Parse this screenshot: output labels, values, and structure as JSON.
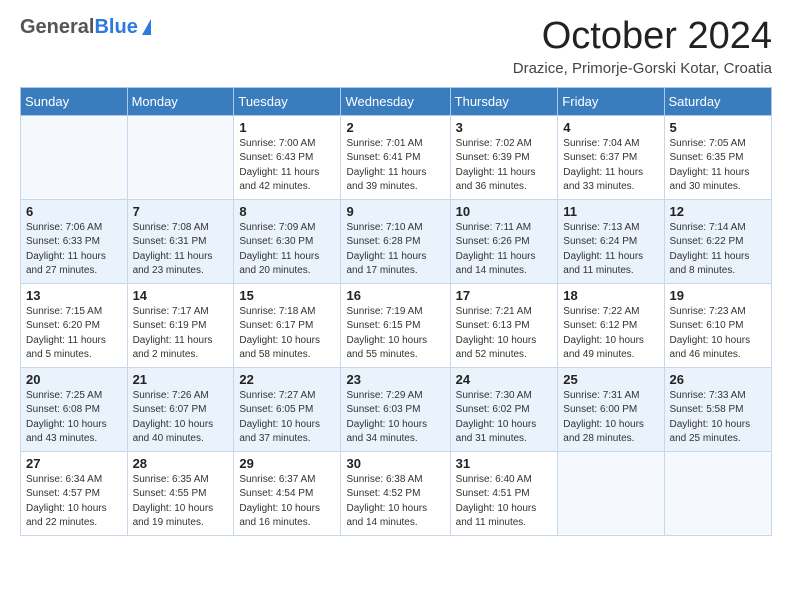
{
  "header": {
    "logo_general": "General",
    "logo_blue": "Blue",
    "title": "October 2024",
    "location": "Drazice, Primorje-Gorski Kotar, Croatia"
  },
  "days_of_week": [
    "Sunday",
    "Monday",
    "Tuesday",
    "Wednesday",
    "Thursday",
    "Friday",
    "Saturday"
  ],
  "weeks": [
    [
      {
        "day": "",
        "info": ""
      },
      {
        "day": "",
        "info": ""
      },
      {
        "day": "1",
        "info": "Sunrise: 7:00 AM\nSunset: 6:43 PM\nDaylight: 11 hours and 42 minutes."
      },
      {
        "day": "2",
        "info": "Sunrise: 7:01 AM\nSunset: 6:41 PM\nDaylight: 11 hours and 39 minutes."
      },
      {
        "day": "3",
        "info": "Sunrise: 7:02 AM\nSunset: 6:39 PM\nDaylight: 11 hours and 36 minutes."
      },
      {
        "day": "4",
        "info": "Sunrise: 7:04 AM\nSunset: 6:37 PM\nDaylight: 11 hours and 33 minutes."
      },
      {
        "day": "5",
        "info": "Sunrise: 7:05 AM\nSunset: 6:35 PM\nDaylight: 11 hours and 30 minutes."
      }
    ],
    [
      {
        "day": "6",
        "info": "Sunrise: 7:06 AM\nSunset: 6:33 PM\nDaylight: 11 hours and 27 minutes."
      },
      {
        "day": "7",
        "info": "Sunrise: 7:08 AM\nSunset: 6:31 PM\nDaylight: 11 hours and 23 minutes."
      },
      {
        "day": "8",
        "info": "Sunrise: 7:09 AM\nSunset: 6:30 PM\nDaylight: 11 hours and 20 minutes."
      },
      {
        "day": "9",
        "info": "Sunrise: 7:10 AM\nSunset: 6:28 PM\nDaylight: 11 hours and 17 minutes."
      },
      {
        "day": "10",
        "info": "Sunrise: 7:11 AM\nSunset: 6:26 PM\nDaylight: 11 hours and 14 minutes."
      },
      {
        "day": "11",
        "info": "Sunrise: 7:13 AM\nSunset: 6:24 PM\nDaylight: 11 hours and 11 minutes."
      },
      {
        "day": "12",
        "info": "Sunrise: 7:14 AM\nSunset: 6:22 PM\nDaylight: 11 hours and 8 minutes."
      }
    ],
    [
      {
        "day": "13",
        "info": "Sunrise: 7:15 AM\nSunset: 6:20 PM\nDaylight: 11 hours and 5 minutes."
      },
      {
        "day": "14",
        "info": "Sunrise: 7:17 AM\nSunset: 6:19 PM\nDaylight: 11 hours and 2 minutes."
      },
      {
        "day": "15",
        "info": "Sunrise: 7:18 AM\nSunset: 6:17 PM\nDaylight: 10 hours and 58 minutes."
      },
      {
        "day": "16",
        "info": "Sunrise: 7:19 AM\nSunset: 6:15 PM\nDaylight: 10 hours and 55 minutes."
      },
      {
        "day": "17",
        "info": "Sunrise: 7:21 AM\nSunset: 6:13 PM\nDaylight: 10 hours and 52 minutes."
      },
      {
        "day": "18",
        "info": "Sunrise: 7:22 AM\nSunset: 6:12 PM\nDaylight: 10 hours and 49 minutes."
      },
      {
        "day": "19",
        "info": "Sunrise: 7:23 AM\nSunset: 6:10 PM\nDaylight: 10 hours and 46 minutes."
      }
    ],
    [
      {
        "day": "20",
        "info": "Sunrise: 7:25 AM\nSunset: 6:08 PM\nDaylight: 10 hours and 43 minutes."
      },
      {
        "day": "21",
        "info": "Sunrise: 7:26 AM\nSunset: 6:07 PM\nDaylight: 10 hours and 40 minutes."
      },
      {
        "day": "22",
        "info": "Sunrise: 7:27 AM\nSunset: 6:05 PM\nDaylight: 10 hours and 37 minutes."
      },
      {
        "day": "23",
        "info": "Sunrise: 7:29 AM\nSunset: 6:03 PM\nDaylight: 10 hours and 34 minutes."
      },
      {
        "day": "24",
        "info": "Sunrise: 7:30 AM\nSunset: 6:02 PM\nDaylight: 10 hours and 31 minutes."
      },
      {
        "day": "25",
        "info": "Sunrise: 7:31 AM\nSunset: 6:00 PM\nDaylight: 10 hours and 28 minutes."
      },
      {
        "day": "26",
        "info": "Sunrise: 7:33 AM\nSunset: 5:58 PM\nDaylight: 10 hours and 25 minutes."
      }
    ],
    [
      {
        "day": "27",
        "info": "Sunrise: 6:34 AM\nSunset: 4:57 PM\nDaylight: 10 hours and 22 minutes."
      },
      {
        "day": "28",
        "info": "Sunrise: 6:35 AM\nSunset: 4:55 PM\nDaylight: 10 hours and 19 minutes."
      },
      {
        "day": "29",
        "info": "Sunrise: 6:37 AM\nSunset: 4:54 PM\nDaylight: 10 hours and 16 minutes."
      },
      {
        "day": "30",
        "info": "Sunrise: 6:38 AM\nSunset: 4:52 PM\nDaylight: 10 hours and 14 minutes."
      },
      {
        "day": "31",
        "info": "Sunrise: 6:40 AM\nSunset: 4:51 PM\nDaylight: 10 hours and 11 minutes."
      },
      {
        "day": "",
        "info": ""
      },
      {
        "day": "",
        "info": ""
      }
    ]
  ]
}
